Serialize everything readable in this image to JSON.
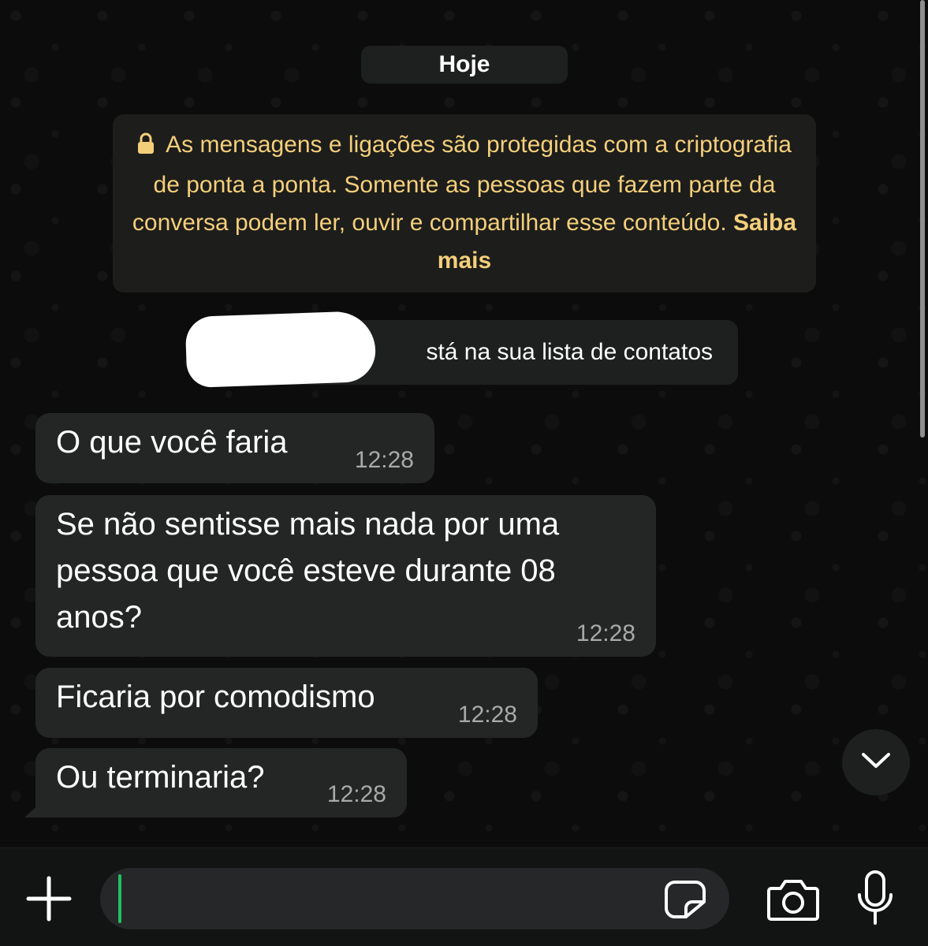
{
  "chat": {
    "date_label": "Hoje",
    "encryption_notice": {
      "text": "As mensagens e ligações são protegidas com a criptografia de ponta a ponta. Somente as pessoas que fazem parte da conversa podem ler, ouvir e compartilhar esse conteúdo.",
      "link": "Saiba mais",
      "icon": "lock-icon"
    },
    "contact_notice": "stá na sua lista de contatos",
    "messages": [
      {
        "text": "O que você faria",
        "time": "12:28"
      },
      {
        "text": "Se não sentisse mais nada por uma pessoa que você esteve durante 08 anos?",
        "time": "12:28"
      },
      {
        "text": "Ficaria por comodismo",
        "time": "12:28"
      },
      {
        "text": "Ou terminaria?",
        "time": "12:28"
      }
    ]
  },
  "input_bar": {
    "message_value": "",
    "icons": [
      "plus-icon",
      "sticker-icon",
      "camera-icon",
      "microphone-icon"
    ]
  },
  "colors": {
    "background": "#0b0b0b",
    "bubble": "#242626",
    "notice_text": "#f4cf7b",
    "caret": "#21c063"
  }
}
